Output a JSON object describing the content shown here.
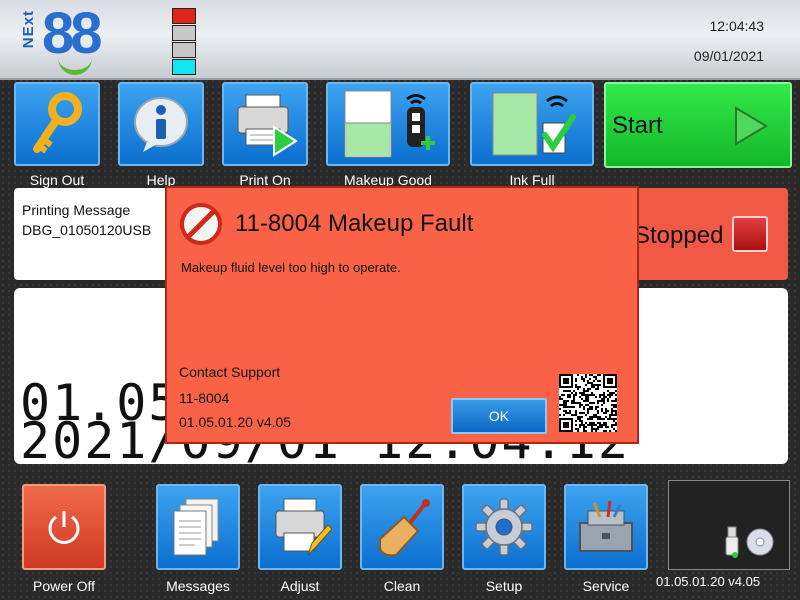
{
  "header": {
    "logo_next": "NExt",
    "logo_num": "88",
    "time": "12:04:43",
    "date": "09/01/2021",
    "beacon_colors": [
      "#e3241c",
      "#c8c8c8",
      "#c8c8c8",
      "#12e6f0"
    ]
  },
  "toolbar": {
    "sign_out": "Sign Out",
    "help": "Help",
    "print_on": "Print On",
    "makeup_good": "Makeup Good",
    "ink_full": "Ink Full",
    "start": "Start"
  },
  "message_panel": {
    "label": "Printing Message",
    "name": "DBG_01050120USB"
  },
  "status_panel": {
    "text": "Stopped"
  },
  "preview": {
    "line1": "01.05.01.20 v4.05",
    "line2": "2021/09/01 12:04:12"
  },
  "bottom": {
    "power_off": "Power Off",
    "messages": "Messages",
    "adjust": "Adjust",
    "clean": "Clean",
    "setup": "Setup",
    "service": "Service",
    "version": "01.05.01.20 v4.05"
  },
  "dialog": {
    "title": "11-8004 Makeup Fault",
    "description": "Makeup fluid level too high to operate.",
    "contact": "Contact Support",
    "code": "11-8004",
    "version": "01.05.01.20 v4.05",
    "ok": "OK"
  },
  "colors": {
    "accent_blue": "#1584e0",
    "start_green": "#1fd43a",
    "fault_red": "#fa6248"
  }
}
